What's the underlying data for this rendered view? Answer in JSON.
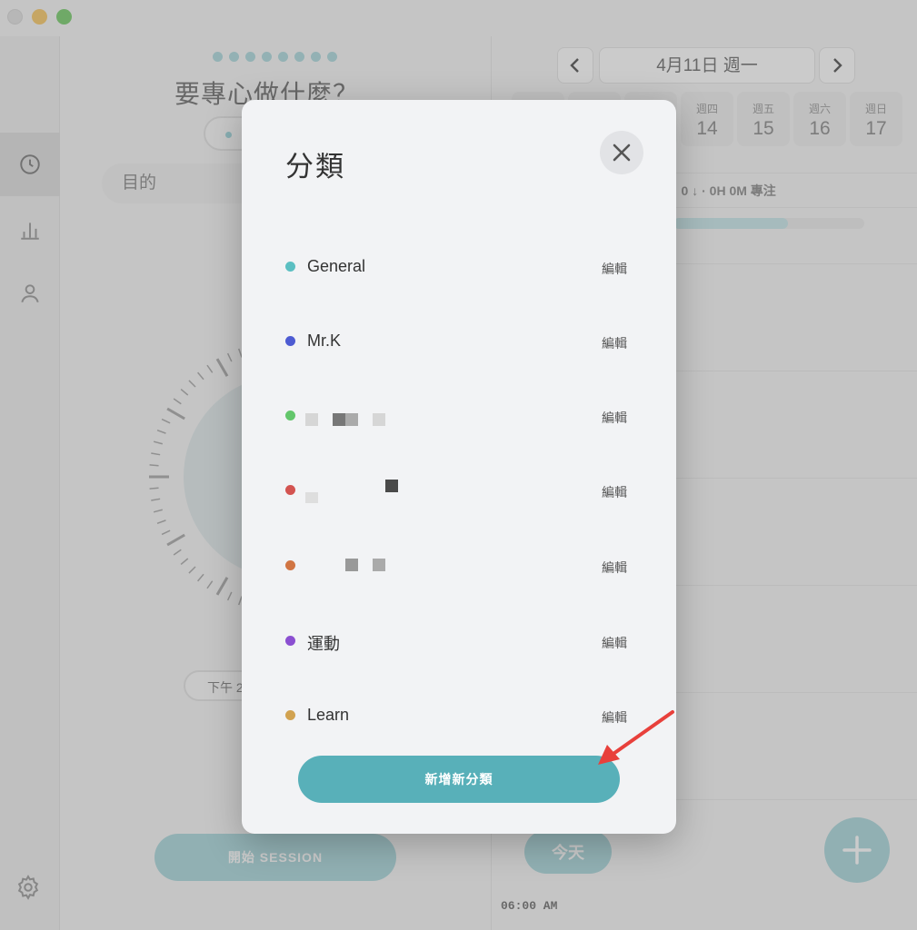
{
  "background": {
    "focus_title": "要專心做什麼？",
    "purpose_placeholder": "目的",
    "time_pill": "下午 2",
    "start_button": "開始 SESSION",
    "date_label": "4月11日 週一",
    "week": [
      {
        "name": "",
        "num": ""
      },
      {
        "name": "",
        "num": ""
      },
      {
        "name": "",
        "num": ""
      },
      {
        "name": "週四",
        "num": "14"
      },
      {
        "name": "週五",
        "num": "15"
      },
      {
        "name": "週六",
        "num": "16"
      },
      {
        "name": "週日",
        "num": "17"
      }
    ],
    "summary": "· 0 ↓ · 0H 0M 專注",
    "today_button": "今天",
    "time_label": "06:00 AM",
    "progress": 0.6
  },
  "modal": {
    "title": "分類",
    "edit_label": "編輯",
    "add_button": "新增新分類",
    "categories": [
      {
        "name": "General",
        "color": "#5bbfc2"
      },
      {
        "name": "Mr.K",
        "color": "#4d5bd2"
      },
      {
        "name": "",
        "color": "#63c66b"
      },
      {
        "name": "",
        "color": "#d35350"
      },
      {
        "name": "",
        "color": "#d17543"
      },
      {
        "name": "運動",
        "color": "#8b4fd1"
      },
      {
        "name": "Learn",
        "color": "#d1a250"
      }
    ]
  },
  "colors": {
    "accent": "#58b0b9",
    "arrow": "#e8403b"
  }
}
